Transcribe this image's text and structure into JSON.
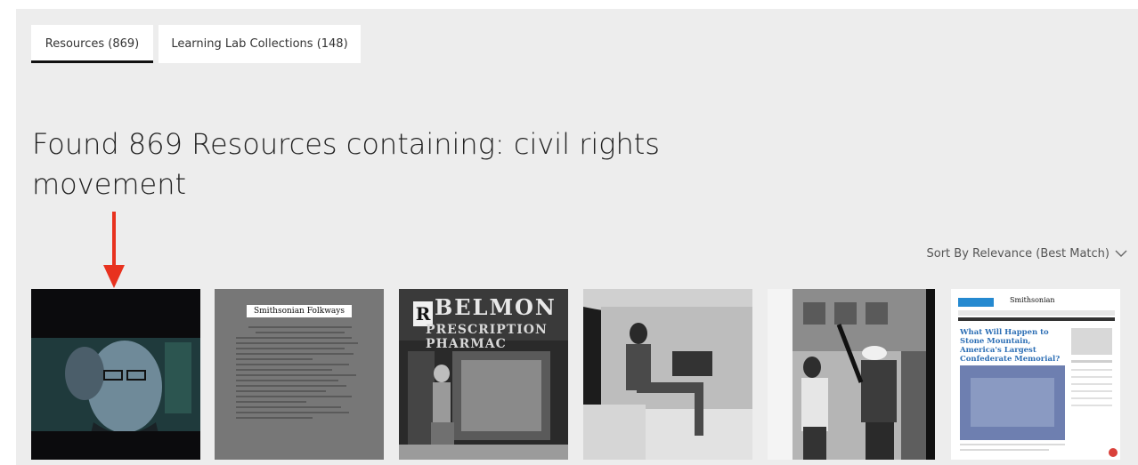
{
  "tabs": [
    {
      "label": "Resources (869)",
      "active": true
    },
    {
      "label": "Learning Lab Collections (148)",
      "active": false
    }
  ],
  "heading": {
    "line1": "Found 869 Resources containing: civil rights",
    "line2": "movement"
  },
  "annotation": {
    "arrow_color": "#e8321f"
  },
  "sort": {
    "label": "Sort By Relevance (Best Match)",
    "icon": "chevron-down-icon"
  },
  "results": [
    {
      "name": "animated-portrait"
    },
    {
      "name": "smithsonian-folkways-document",
      "brand": "Smithsonian Folkways"
    },
    {
      "name": "belmont-pharmacy-photo",
      "sign_top": "BELMON",
      "sign_bottom": "PRESCRIPTION PHARMAC",
      "letter": "R"
    },
    {
      "name": "man-in-van-photo"
    },
    {
      "name": "police-arrest-photo"
    },
    {
      "name": "smithsonian-article",
      "brand": "Smithsonian",
      "title": "What Will Happen to Stone Mountain, America's Largest Confederate Memorial?"
    }
  ],
  "colors": {
    "panel_bg": "#ededed",
    "tab_bg": "#ffffff",
    "active_underline": "#111111",
    "link_blue": "#2d6fb5"
  }
}
